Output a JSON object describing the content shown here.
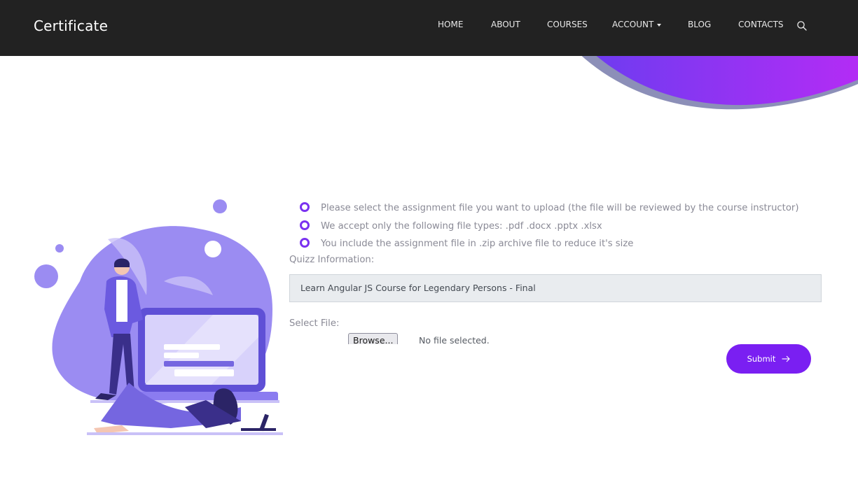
{
  "header": {
    "brand": "Certificate",
    "nav": [
      {
        "label": "HOME"
      },
      {
        "label": "ABOUT"
      },
      {
        "label": "COURSES"
      },
      {
        "label": "ACCOUNT",
        "has_dropdown": true
      },
      {
        "label": "BLOG"
      },
      {
        "label": "CONTACTS"
      }
    ],
    "search_icon": "search-icon"
  },
  "colors": {
    "accent": "#7a1ff2",
    "navbar": "#222222",
    "blob_gradient": [
      "#6d3cf0",
      "#b32cf5"
    ],
    "illustration": "#9b8cf2"
  },
  "main": {
    "info_items": [
      "Please select the assignment file you want to upload (the file will be reviewed by the course instructor)",
      "We accept only the following file types: .pdf .docx .pptx .xlsx",
      "You include the assignment file in .zip archive file to reduce it's size"
    ],
    "quiz_label": "Quizz Information:",
    "quiz_value": "Learn Angular JS Course for Legendary Persons - Final",
    "file_label": "Select File:",
    "browse_label": "Browse...",
    "file_status": "No file selected.",
    "submit_label": "Submit",
    "submit_icon": "arrow-right-icon"
  }
}
